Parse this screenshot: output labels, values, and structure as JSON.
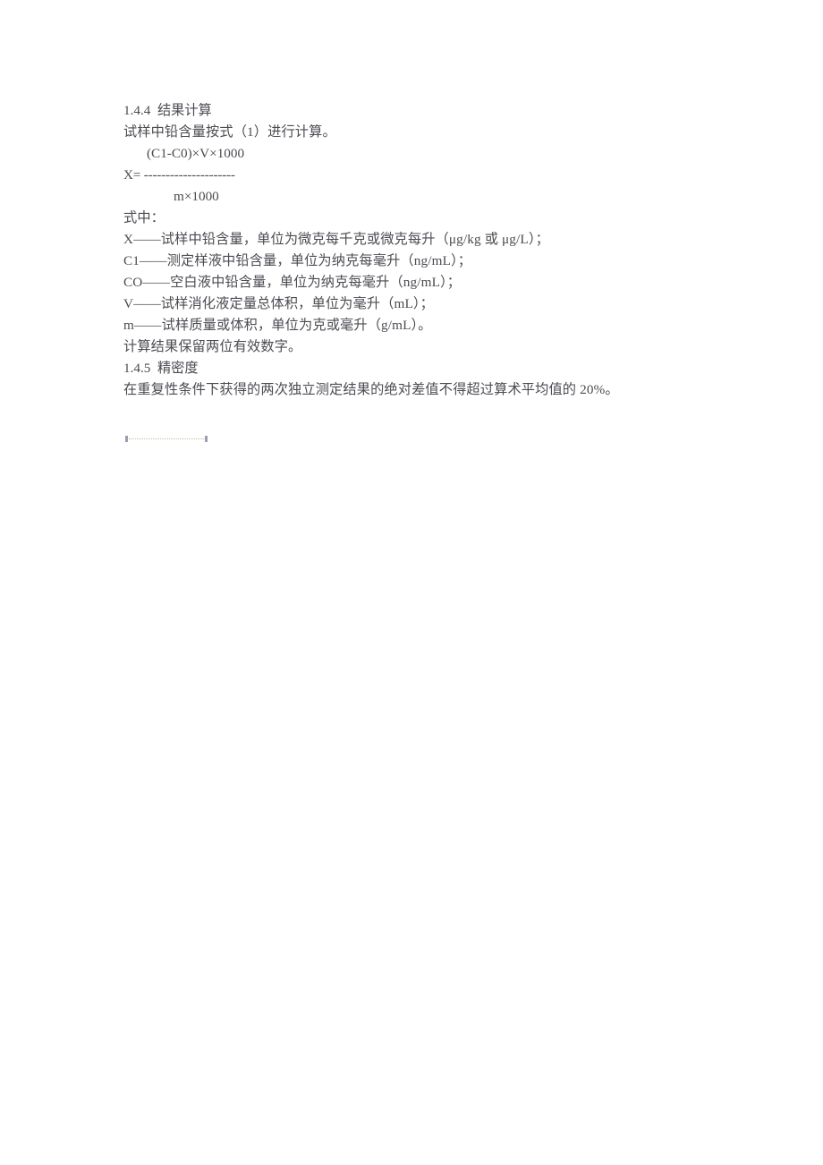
{
  "document": {
    "background_color": "#ffffff",
    "text_color": "#4b4b52",
    "sections": {
      "calc": {
        "heading": "1.4.4  结果计算",
        "intro": "试样中铅含量按式（1）进行计算。",
        "formula": {
          "numerator": "(C1-C0)×V×1000",
          "bar": "X= ---------------------",
          "denominator": "m×1000"
        },
        "where_label": "式中：",
        "definitions": [
          "X——试样中铅含量，单位为微克每千克或微克每升（μg/kg 或 μg/L）；",
          "C1——测定样液中铅含量，单位为纳克每毫升（ng/mL）；",
          "CO——空白液中铅含量，单位为纳克每毫升（ng/mL）；",
          "V——试样消化液定量总体积，单位为毫升（mL）；",
          "m——试样质量或体积，单位为克或毫升（g/mL）。"
        ],
        "note": "计算结果保留两位有效数字。"
      },
      "precision": {
        "heading": "1.4.5  精密度",
        "body": "在重复性条件下获得的两次独立测定结果的绝对差值不得超过算术平均值的 20%。"
      }
    },
    "artifact": {
      "name": "dotted-line-artifact",
      "color": "#c9b79a",
      "cap_color": "#8c8ca0"
    }
  }
}
